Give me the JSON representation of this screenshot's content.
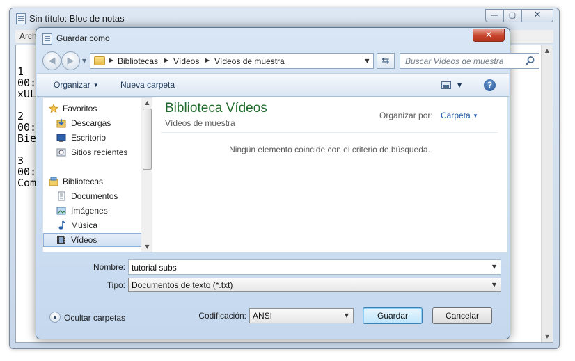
{
  "notepad": {
    "title": "Sin título: Bloc de notas",
    "menu_visible": "Arch",
    "controls": {
      "minimize": "—",
      "maximize": "▢",
      "close": "✕"
    },
    "text_lines": [
      "",
      "1",
      "00:",
      "xUL",
      "",
      "2",
      "00:",
      "Bie",
      "",
      "3",
      "00:",
      "Com"
    ]
  },
  "dialog": {
    "title": "Guardar como",
    "close": "✕",
    "breadcrumbs": [
      "Bibliotecas",
      "Vídeos",
      "Vídeos de muestra"
    ],
    "search_placeholder": "Buscar Vídeos de muestra",
    "toolbar": {
      "organize": "Organizar",
      "new_folder": "Nueva carpeta",
      "help": "?"
    },
    "nav": {
      "favorites": "Favoritos",
      "downloads": "Descargas",
      "desktop": "Escritorio",
      "recent": "Sitios recientes",
      "libraries": "Bibliotecas",
      "documents": "Documentos",
      "images": "Imágenes",
      "music": "Música",
      "videos": "Vídeos",
      "selected": "Vídeos"
    },
    "content": {
      "library_title": "Biblioteca Vídeos",
      "library_subtitle": "Vídeos de muestra",
      "arrange_label": "Organizar por:",
      "arrange_value": "Carpeta",
      "empty_message": "Ningún elemento coincide con el criterio de búsqueda."
    },
    "form": {
      "filename_label": "Nombre:",
      "filename_value": "tutorial subs",
      "type_label": "Tipo:",
      "type_value": "Documentos de texto (*.txt)",
      "encoding_label": "Codificación:",
      "encoding_value": "ANSI"
    },
    "buttons": {
      "hide_folders": "Ocultar carpetas",
      "save": "Guardar",
      "cancel": "Cancelar"
    }
  },
  "colors": {
    "library_title": "#1e6b2b",
    "link_blue": "#1e5aa8",
    "close_red": "#c6452e"
  }
}
